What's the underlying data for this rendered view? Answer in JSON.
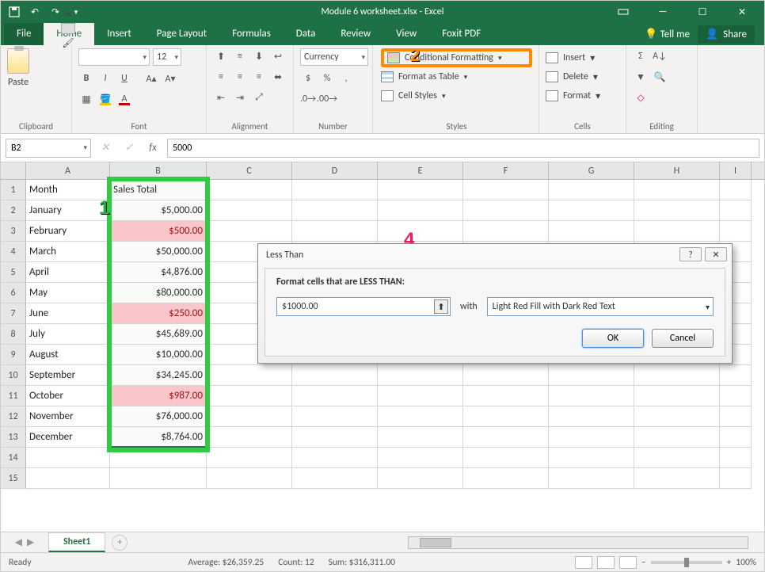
{
  "title": "Module 6 worksheet.xlsx - Excel",
  "tabs": {
    "file": "File",
    "home": "Home",
    "insert": "Insert",
    "pagelayout": "Page Layout",
    "formulas": "Formulas",
    "data": "Data",
    "review": "Review",
    "view": "View",
    "foxit": "Foxit PDF",
    "tellme": "Tell me",
    "share": "Share"
  },
  "ribbon": {
    "clipboard": {
      "paste": "Paste",
      "label": "Clipboard"
    },
    "font": {
      "name": "",
      "size": "12",
      "label": "Font"
    },
    "alignment": {
      "label": "Alignment"
    },
    "number": {
      "format": "Currency",
      "label": "Number"
    },
    "styles": {
      "cf": "Conditional Formatting",
      "fat": "Format as Table",
      "cs": "Cell Styles",
      "label": "Styles"
    },
    "cells": {
      "insert": "Insert",
      "delete": "Delete",
      "format": "Format",
      "label": "Cells"
    },
    "editing": {
      "label": "Editing"
    }
  },
  "namebox": "B2",
  "formula": "5000",
  "columns": [
    "A",
    "B",
    "C",
    "D",
    "E",
    "F",
    "G",
    "H",
    "I"
  ],
  "rows": [
    {
      "n": 1,
      "a": "Month",
      "b": "Sales Total",
      "ba": "l",
      "red": false
    },
    {
      "n": 2,
      "a": "January",
      "b": "$5,000.00",
      "ba": "r",
      "red": false
    },
    {
      "n": 3,
      "a": "February",
      "b": "$500.00",
      "ba": "r",
      "red": true
    },
    {
      "n": 4,
      "a": "March",
      "b": "$50,000.00",
      "ba": "r",
      "red": false
    },
    {
      "n": 5,
      "a": "April",
      "b": "$4,876.00",
      "ba": "r",
      "red": false
    },
    {
      "n": 6,
      "a": "May",
      "b": "$80,000.00",
      "ba": "r",
      "red": false
    },
    {
      "n": 7,
      "a": "June",
      "b": "$250.00",
      "ba": "r",
      "red": true
    },
    {
      "n": 8,
      "a": "July",
      "b": "$45,689.00",
      "ba": "r",
      "red": false
    },
    {
      "n": 9,
      "a": "August",
      "b": "$10,000.00",
      "ba": "r",
      "red": false
    },
    {
      "n": 10,
      "a": "September",
      "b": "$34,245.00",
      "ba": "r",
      "red": false
    },
    {
      "n": 11,
      "a": "October",
      "b": "$987.00",
      "ba": "r",
      "red": true
    },
    {
      "n": 12,
      "a": "November",
      "b": "$76,000.00",
      "ba": "r",
      "red": false
    },
    {
      "n": 13,
      "a": "December",
      "b": "$8,764.00",
      "ba": "r",
      "red": false
    },
    {
      "n": 14,
      "a": "",
      "b": "",
      "ba": "l",
      "red": false
    },
    {
      "n": 15,
      "a": "",
      "b": "",
      "ba": "l",
      "red": false
    }
  ],
  "dialog": {
    "title": "Less Than",
    "label": "Format cells that are LESS THAN:",
    "value": "$1000.00",
    "with": "with",
    "format": "Light Red Fill with Dark Red Text",
    "ok": "OK",
    "cancel": "Cancel"
  },
  "sheet": {
    "name": "Sheet1"
  },
  "status": {
    "ready": "Ready",
    "avg": "Average: $26,359.25",
    "count": "Count: 12",
    "sum": "Sum: $316,311.00",
    "zoom": "100%"
  },
  "callouts": {
    "c1": "1",
    "c2": "2",
    "c4": "4"
  }
}
